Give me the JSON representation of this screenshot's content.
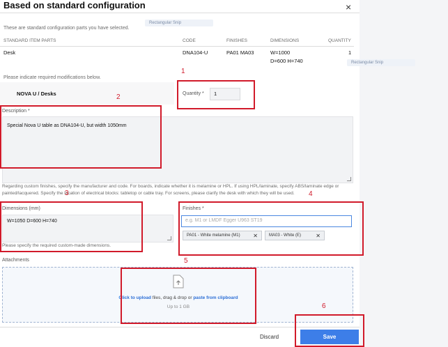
{
  "dialog": {
    "title": "Based on standard configuration",
    "close_label": "×",
    "intro": "These are standard configuration parts you have selected.",
    "ghost_tag_1": "Rectangular Snip",
    "ghost_tag_2": "Rectangular Snip"
  },
  "table": {
    "headers": [
      "STANDARD ITEM PARTS",
      "CODE",
      "FINISHES",
      "DIMENSIONS",
      "QUANTITY"
    ],
    "row": {
      "part": "Desk",
      "code": "DNA104-U",
      "finishes": "PA01 MA03",
      "dim_line1": "W=1000",
      "dim_line2": "D=600 H=740",
      "quantity": "1"
    }
  },
  "modifications": {
    "instruction": "Please indicate required modifications below.",
    "product_name": "NOVA U / Desks",
    "quantity_label": "Quantity *",
    "quantity_value": "1",
    "description_label": "Description *",
    "description_value": "Special Nova U table as DNA104-U, but width 1050mm",
    "custom_note_1": "Regarding custom finishes, specify the manufacturer and code. For boards, indicate whether it is melamine or HPL. If using HPL/laminate, specify ABS/laminate edge or",
    "custom_note_2": "painted/lacquered. Specify the location of electrical blocks: tabletop or cable tray. For screens, please clarify the desk with which they will be used.",
    "dimensions_label": "Dimensions (mm)",
    "dimensions_value": "W=1050 D=600 H=740",
    "dimensions_hint": "Please specify the required custom-made dimensions.",
    "finishes_label": "Finishes *",
    "finishes_placeholder": "e.g. M1 or LMDF Egger U963 ST19",
    "finish_chips": [
      "PA01 - White melamine (M1)",
      "MA03 - White (E)"
    ],
    "chip_remove": "✕"
  },
  "attachments": {
    "label": "Attachments",
    "click_text": "Click to upload",
    "middle_text": " files, drag & drop or ",
    "paste_text": "paste from clipboard",
    "limit": "Up to 1 GB"
  },
  "footer": {
    "discard_label": "Discard",
    "save_label": "Save"
  },
  "annotations": [
    "1",
    "2",
    "3",
    "4",
    "5",
    "6"
  ],
  "colors": {
    "annotation_red": "#d11a2a",
    "save_blue": "#3d7ee8",
    "link_blue": "#2d6fd6"
  }
}
